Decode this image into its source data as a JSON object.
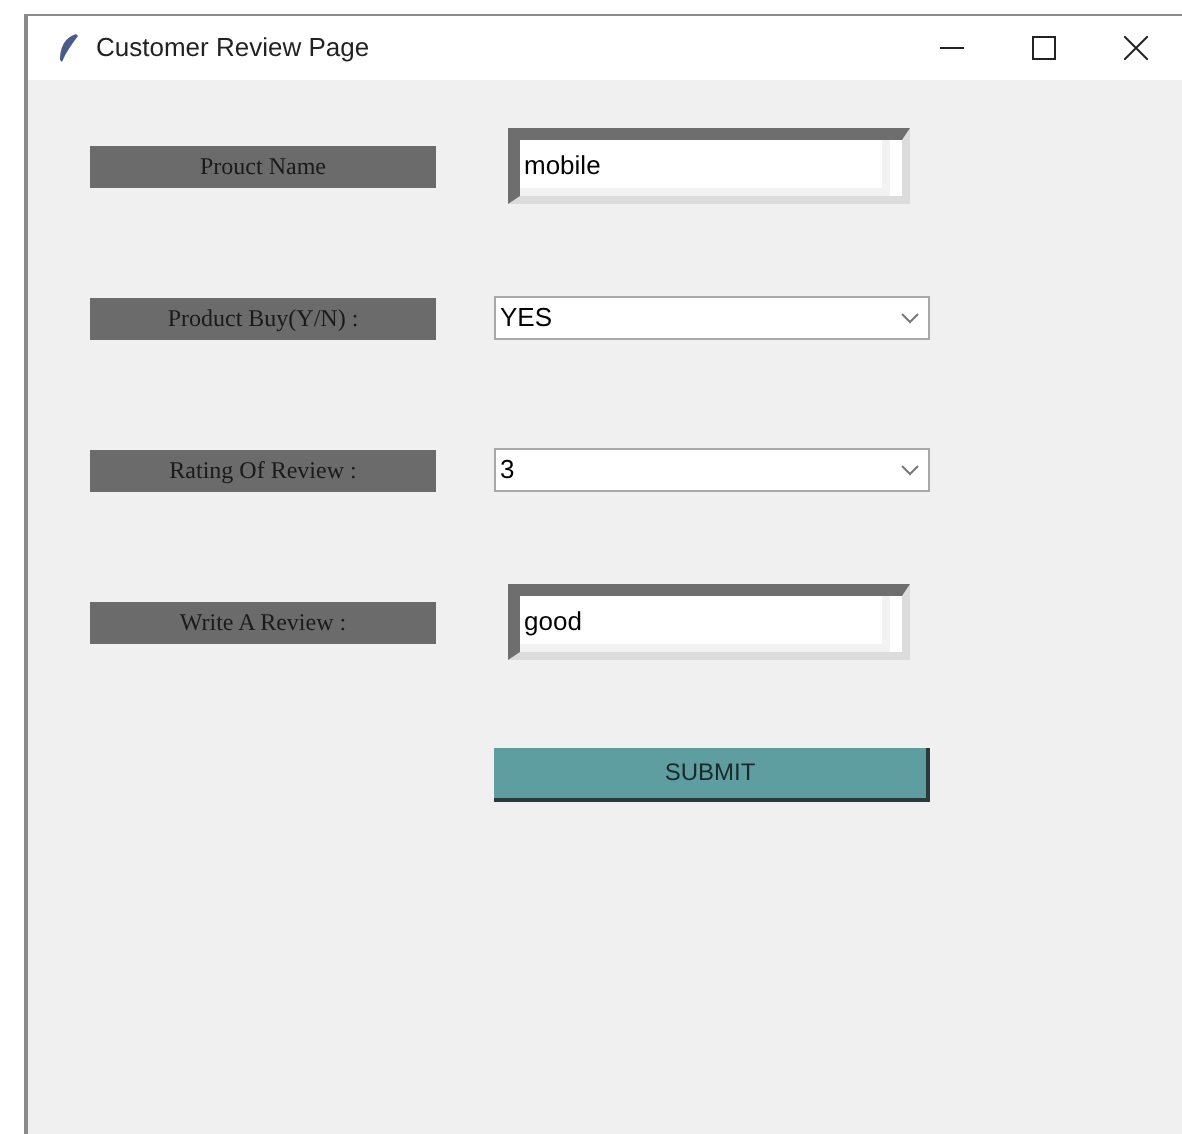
{
  "window": {
    "title": "Customer Review Page"
  },
  "fields": [
    {
      "label": "Prouct Name",
      "kind": "entry",
      "value": "mobile"
    },
    {
      "label": "Product Buy(Y/N) :",
      "kind": "combobox",
      "value": "YES"
    },
    {
      "label": "Rating Of Review :",
      "kind": "combobox",
      "value": "3"
    },
    {
      "label": "Write A Review :",
      "kind": "entry",
      "value": "good"
    }
  ],
  "submit": {
    "label": "SUBMIT"
  }
}
